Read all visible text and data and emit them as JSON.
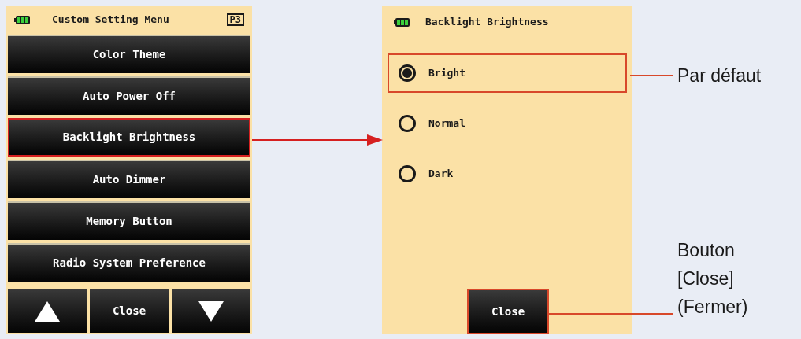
{
  "menu_screen": {
    "title": "Custom Setting Menu",
    "page": "P3",
    "items": [
      {
        "label": "Color Theme",
        "highlighted": false
      },
      {
        "label": "Auto Power Off",
        "highlighted": false
      },
      {
        "label": "Backlight Brightness",
        "highlighted": true
      },
      {
        "label": "Auto Dimmer",
        "highlighted": false
      },
      {
        "label": "Memory Button",
        "highlighted": false
      },
      {
        "label": "Radio System Preference",
        "highlighted": false
      }
    ],
    "close_button": "Close"
  },
  "settings_screen": {
    "title": "Backlight Brightness",
    "options": [
      {
        "label": "Bright",
        "selected": true,
        "highlighted": true
      },
      {
        "label": "Normal",
        "selected": false,
        "highlighted": false
      },
      {
        "label": "Dark",
        "selected": false,
        "highlighted": false
      }
    ],
    "close_button": {
      "label": "Close",
      "highlighted": true
    }
  },
  "callouts": [
    {
      "lines": [
        "Par défaut"
      ]
    },
    {
      "lines": [
        "Bouton",
        "[Close]",
        "(Fermer)"
      ]
    }
  ]
}
